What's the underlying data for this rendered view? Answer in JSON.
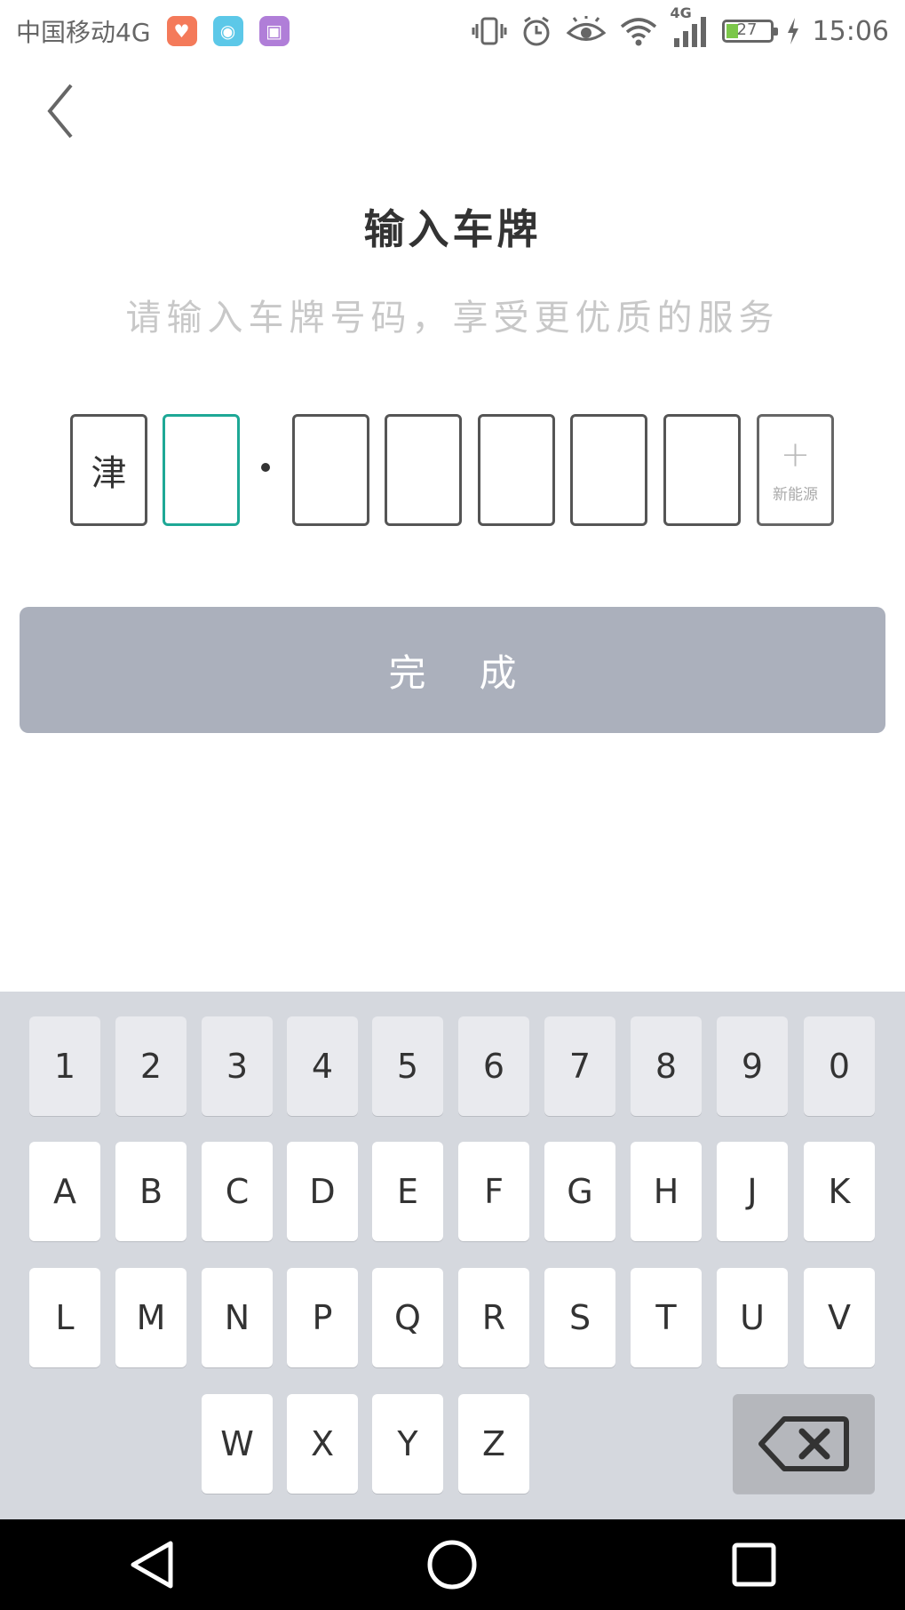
{
  "status_bar": {
    "carrier": "中国移动4G",
    "network_label": "4G",
    "battery_level": "27",
    "time": "15:06",
    "app_icons": [
      "health-app-icon",
      "android-app-icon",
      "gallery-app-icon"
    ]
  },
  "header": {
    "title": "输入车牌",
    "subtitle": "请输入车牌号码，享受更优质的服务"
  },
  "plate": {
    "slots": [
      "津",
      "",
      "",
      "",
      "",
      "",
      ""
    ],
    "active_index": 1,
    "new_energy_plus": "+",
    "new_energy_label": "新能源"
  },
  "done_button": {
    "label": "完成"
  },
  "keyboard": {
    "row1": [
      "1",
      "2",
      "3",
      "4",
      "5",
      "6",
      "7",
      "8",
      "9",
      "0"
    ],
    "row2": [
      "A",
      "B",
      "C",
      "D",
      "E",
      "F",
      "G",
      "H",
      "J",
      "K"
    ],
    "row3": [
      "L",
      "M",
      "N",
      "P",
      "Q",
      "R",
      "S",
      "T",
      "U",
      "V"
    ],
    "row4": [
      "W",
      "X",
      "Y",
      "Z"
    ]
  },
  "colors": {
    "active_border": "#1ea896",
    "done_button_bg": "#abb0bc",
    "keyboard_bg": "#d5d8de"
  }
}
